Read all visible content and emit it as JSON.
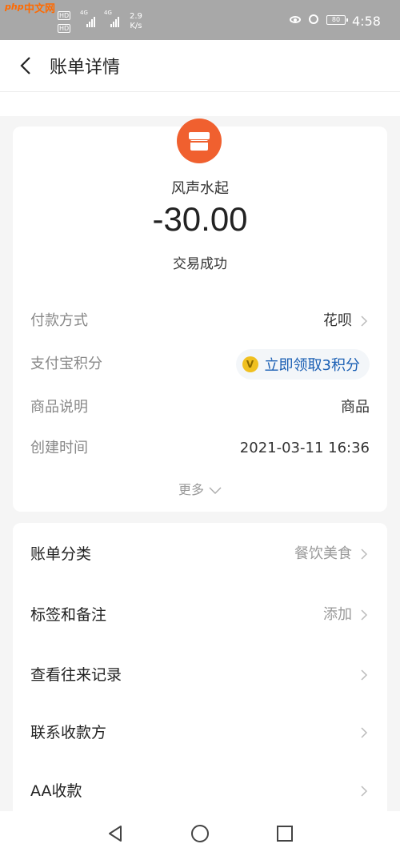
{
  "status_bar": {
    "watermark": "中文网",
    "watermark_logo": "php",
    "hd_badge": "HD",
    "net_left": "4G",
    "net_right": "4G",
    "speed": "2.9",
    "speed_unit": "K/s",
    "battery": "80",
    "time": "4:58"
  },
  "header": {
    "title": "账单详情",
    "back_icon": "chevron-left-icon"
  },
  "summary": {
    "merchant_icon": "storefront-icon",
    "merchant_color": "#f0602f",
    "merchant_name": "风声水起",
    "amount": "-30.00",
    "status": "交易成功"
  },
  "details": {
    "payment_method": {
      "label": "付款方式",
      "value": "花呗"
    },
    "points": {
      "label": "支付宝积分",
      "coin": "V",
      "value": "立即领取3积分"
    },
    "description": {
      "label": "商品说明",
      "value": "商品"
    },
    "created": {
      "label": "创建时间",
      "value": "2021-03-11 16:36"
    },
    "more_label": "更多"
  },
  "actions": {
    "category": {
      "label": "账单分类",
      "value": "餐饮美食"
    },
    "tags": {
      "label": "标签和备注",
      "value": "添加"
    },
    "history": {
      "label": "查看往来记录"
    },
    "contact": {
      "label": "联系收款方"
    },
    "aa": {
      "label": "AA收款"
    }
  },
  "colors": {
    "accent_blue": "#1a5fb4",
    "merchant_orange": "#f0602f",
    "coin_gold": "#f0c020"
  }
}
